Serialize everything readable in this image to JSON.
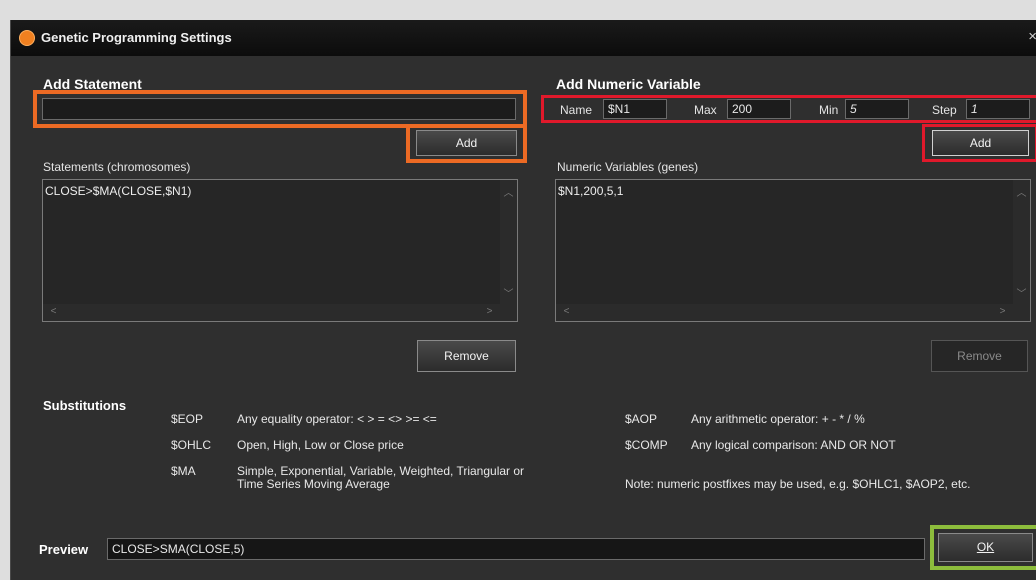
{
  "window": {
    "title": "Genetic Programming Settings",
    "close": "×"
  },
  "add_statement": {
    "header": "Add Statement",
    "value": "",
    "add_label": "Add"
  },
  "statements": {
    "label": "Statements (chromosomes)",
    "items": "CLOSE>$MA(CLOSE,$N1)",
    "remove_label": "Remove"
  },
  "add_numeric": {
    "header": "Add Numeric Variable",
    "name_label": "Name",
    "name_value": "$N1",
    "max_label": "Max",
    "max_value": "200",
    "min_label": "Min",
    "min_value": "5",
    "step_label": "Step",
    "step_value": "1",
    "add_label": "Add"
  },
  "numeric_vars": {
    "label": "Numeric Variables (genes)",
    "items": "$N1,200,5,1",
    "remove_label": "Remove"
  },
  "substitutions": {
    "header": "Substitutions",
    "eop_code": "$EOP",
    "eop_desc": "Any equality operator:  <  >  =  <>  >=  <=",
    "ohlc_code": "$OHLC",
    "ohlc_desc": "Open, High, Low or Close price",
    "ma_code": "$MA",
    "ma_desc_1": "Simple, Exponential, Variable, Weighted, Triangular or",
    "ma_desc_2": "Time Series Moving Average",
    "aop_code": "$AOP",
    "aop_desc": "Any arithmetic operator:  +  -  *  /  %",
    "comp_code": "$COMP",
    "comp_desc": "Any logical comparison: AND  OR  NOT",
    "note": "Note: numeric postfixes may be used, e.g. $OHLC1, $AOP2, etc."
  },
  "preview": {
    "label": "Preview",
    "value": "CLOSE>SMA(CLOSE,5)"
  },
  "ok_label": "OK",
  "colors": {
    "highlight_orange": "#ec6a24",
    "highlight_red": "#e0192b",
    "highlight_green": "#8dbd3c",
    "window_bg": "#2f2f2f"
  },
  "icons": {
    "app": "app-logo-icon",
    "close": "close-icon",
    "scroll_up": "chevron-up-icon",
    "scroll_down": "chevron-down-icon",
    "scroll_left": "chevron-left-icon",
    "scroll_right": "chevron-right-icon"
  }
}
